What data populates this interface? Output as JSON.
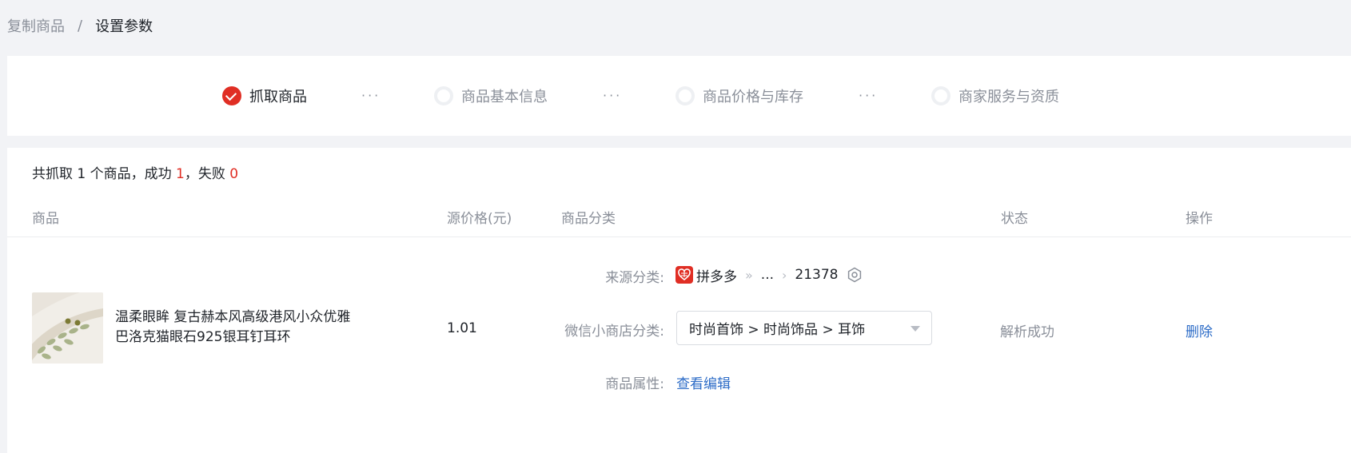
{
  "breadcrumb": {
    "prev": "复制商品",
    "separator": "/",
    "current": "设置参数"
  },
  "steps": {
    "step1": "抓取商品",
    "step2": "商品基本信息",
    "step3": "商品价格与库存",
    "step4": "商家服务与资质",
    "separator": "···"
  },
  "summary": {
    "prefix": "共抓取 1 个商品，成功 ",
    "success": "1",
    "middle": "，失败 ",
    "fail": "0"
  },
  "table": {
    "headers": {
      "product": "商品",
      "price": "源价格(元)",
      "category": "商品分类",
      "status": "状态",
      "action": "操作"
    }
  },
  "row": {
    "title": "温柔眼眸 复古赫本风高级港风小众优雅巴洛克猫眼石925银耳钉耳环",
    "price": "1.01",
    "source_label": "来源分类:",
    "source_platform": "拼多多",
    "source_ellipsis": "...",
    "source_id": "21378",
    "wechat_label": "微信小商店分类:",
    "wechat_value": "时尚首饰 > 时尚饰品 > 耳饰",
    "attr_label": "商品属性:",
    "attr_link": "查看编辑",
    "status": "解析成功",
    "delete": "删除"
  },
  "colors": {
    "accent_red": "#e02e24",
    "link_blue": "#2d6cc7"
  }
}
